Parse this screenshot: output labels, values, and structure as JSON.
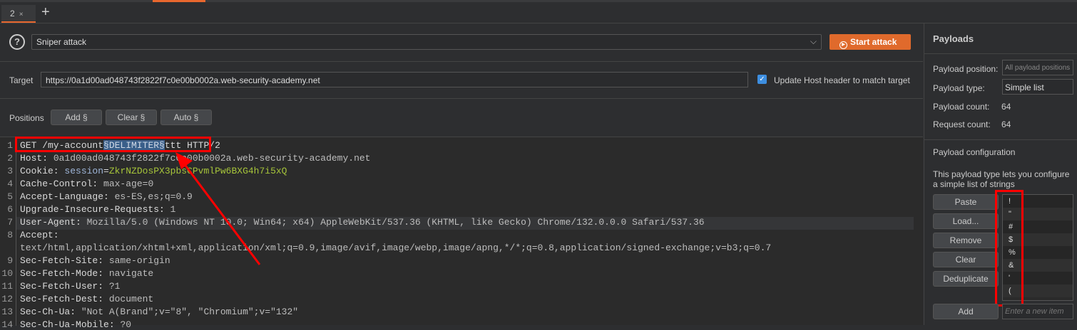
{
  "tabs": {
    "active": "2",
    "close": "×",
    "add": "+"
  },
  "attack": {
    "help": "?",
    "type": "Sniper attack",
    "chevron": "⌵",
    "start": "Start attack"
  },
  "target": {
    "label": "Target",
    "url": "https://0a1d00ad048743f2822f7c0e00b0002a.web-security-academy.net",
    "checkbox": "✓",
    "update_host": "Update Host header to match target"
  },
  "positions": {
    "label": "Positions",
    "add": "Add §",
    "clear": "Clear §",
    "auto": "Auto §"
  },
  "request": {
    "line1": {
      "pre": "GET /my-account",
      "sel": "§DELIMITER§",
      "post": "ttt HTTP/2"
    },
    "host": {
      "k": "Host: ",
      "v": "0a1d00ad048743f2822f7c0e00b0002a.web-security-academy.net"
    },
    "cookie": {
      "k": "Cookie: ",
      "n": "session",
      "eq": "=",
      "v": "ZkrNZDosPX3pbsCPvmlPw6BXG4h7i5xQ"
    },
    "l4": {
      "k": "Cache-Control: ",
      "v": "max-age=0"
    },
    "l5": {
      "k": "Accept-Language: ",
      "v": "es-ES,es;q=0.9"
    },
    "l6": {
      "k": "Upgrade-Insecure-Requests: ",
      "v": "1"
    },
    "l7": {
      "k": "User-Agent: ",
      "v": "Mozilla/5.0 (Windows NT 10.0; Win64; x64) AppleWebKit/537.36 (KHTML, like Gecko) Chrome/132.0.0.0 Safari/537.36"
    },
    "l8": {
      "k": "Accept:",
      "v": "text/html,application/xhtml+xml,application/xml;q=0.9,image/avif,image/webp,image/apng,*/*;q=0.8,application/signed-exchange;v=b3;q=0.7"
    },
    "l9": {
      "k": "Sec-Fetch-Site: ",
      "v": "same-origin"
    },
    "l10": {
      "k": "Sec-Fetch-Mode: ",
      "v": "navigate"
    },
    "l11": {
      "k": "Sec-Fetch-User: ",
      "v": "?1"
    },
    "l12": {
      "k": "Sec-Fetch-Dest: ",
      "v": "document"
    },
    "l13": {
      "k": "Sec-Ch-Ua: ",
      "v": "\"Not A(Brand\";v=\"8\", \"Chromium\";v=\"132\""
    },
    "l14": {
      "k": "Sec-Ch-Ua-Mobile: ",
      "v": "?0"
    },
    "line_numbers": [
      "1",
      "2",
      "3",
      "4",
      "5",
      "6",
      "7",
      "8",
      "9",
      "10",
      "11",
      "12",
      "13",
      "14"
    ]
  },
  "payloads": {
    "title": "Payloads",
    "position_label": "Payload position:",
    "position_value": "All payload positions",
    "type_label": "Payload type:",
    "type_value": "Simple list",
    "count_label": "Payload count:",
    "count": "64",
    "req_label": "Request count:",
    "req_count": "64",
    "config_title": "Payload configuration",
    "config_desc": "This payload type lets you configure a simple list of strings",
    "buttons": [
      "Paste",
      "Load...",
      "Remove",
      "Clear",
      "Deduplicate"
    ],
    "items": [
      "!",
      "\"",
      "#",
      "$",
      "%",
      "&",
      "'",
      "("
    ],
    "add": "Add",
    "add_placeholder": "Enter a new item"
  }
}
